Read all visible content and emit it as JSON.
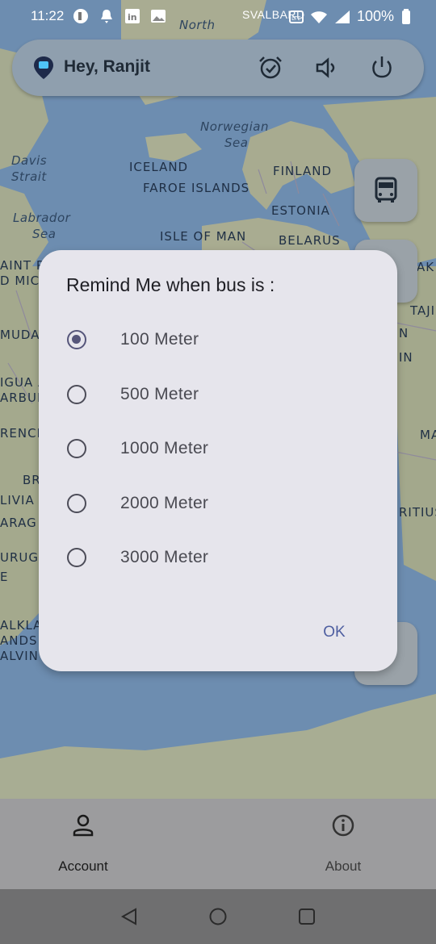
{
  "status_bar": {
    "time": "11:22",
    "battery": "100%"
  },
  "header": {
    "greeting": "Hey, Ranjit",
    "icons": [
      "location-pin-logo-icon",
      "alarm-check-icon",
      "volume-icon",
      "power-icon"
    ]
  },
  "map": {
    "labels": [
      "North",
      "Norwegian",
      "Sea",
      "Davis",
      "Strait",
      "ICELAND",
      "FAROE ISLANDS",
      "FINLAND",
      "Labrador",
      "Sea",
      "ESTONIA",
      "ISLE OF MAN",
      "BELARUS",
      "SVALBARD",
      "AK",
      "TAJI",
      "N",
      "IN",
      "MA",
      "RITIUS",
      "AINT P",
      "D MIC",
      "MUDA",
      "IGUA A",
      "ARBUD",
      "RENCH",
      "BR",
      "LIVIA",
      "ARAG",
      "URUG",
      "E",
      "ALKLA",
      "ANDS",
      "ALVIN"
    ]
  },
  "dialog": {
    "title": "Remind Me when bus is :",
    "options": [
      {
        "label": "100 Meter",
        "selected": true
      },
      {
        "label": "500 Meter",
        "selected": false
      },
      {
        "label": "1000 Meter",
        "selected": false
      },
      {
        "label": "2000 Meter",
        "selected": false
      },
      {
        "label": "3000 Meter",
        "selected": false
      }
    ],
    "ok_label": "OK"
  },
  "bottom_nav": {
    "account_label": "Account",
    "about_label": "About"
  },
  "colors": {
    "dialog_bg": "#e6e5ec",
    "accent": "#4e5ea0",
    "map_water": "#6d8db0",
    "map_land": "#a6ab8f"
  }
}
